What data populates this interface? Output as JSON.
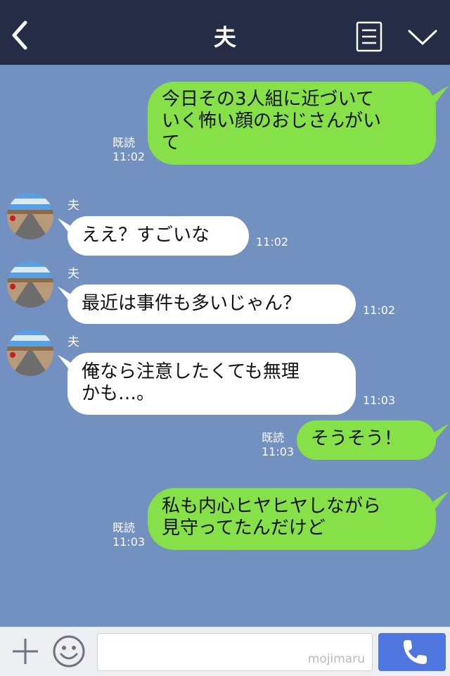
{
  "header": {
    "title": "夫",
    "icons": [
      "back-icon",
      "menu-list-icon",
      "chevron-down-icon"
    ]
  },
  "messages": [
    {
      "side": "right",
      "text": "今日その3人組に近づいて\nいく怖い顔のおじさんがい\nて",
      "read": "既読",
      "time": "11:02"
    },
    {
      "side": "left",
      "sender": "夫",
      "text": "ええ？すごいな",
      "time": "11:02"
    },
    {
      "side": "left",
      "sender": "夫",
      "text": "最近は事件も多いじゃん？",
      "time": "11:02"
    },
    {
      "side": "left",
      "sender": "夫",
      "text": "俺なら注意したくても無理\nかも…。",
      "time": "11:03"
    },
    {
      "side": "right",
      "text": "そうそう！",
      "read": "既読",
      "time": "11:03"
    },
    {
      "side": "right",
      "text": "私も内心ヒヤヒヤしながら\n見守ってたんだけど",
      "read": "既読",
      "time": "11:03"
    }
  ],
  "bottom": {
    "input_placeholder": "",
    "watermark": "mojimaru",
    "icons": [
      "plus-icon",
      "smiley-icon",
      "phone-icon"
    ]
  },
  "colors": {
    "header_bg": "#242d45",
    "chat_bg": "#7290c0",
    "my_bubble": "#86e048",
    "their_bubble": "#ffffff",
    "call_button": "#5077e0"
  }
}
